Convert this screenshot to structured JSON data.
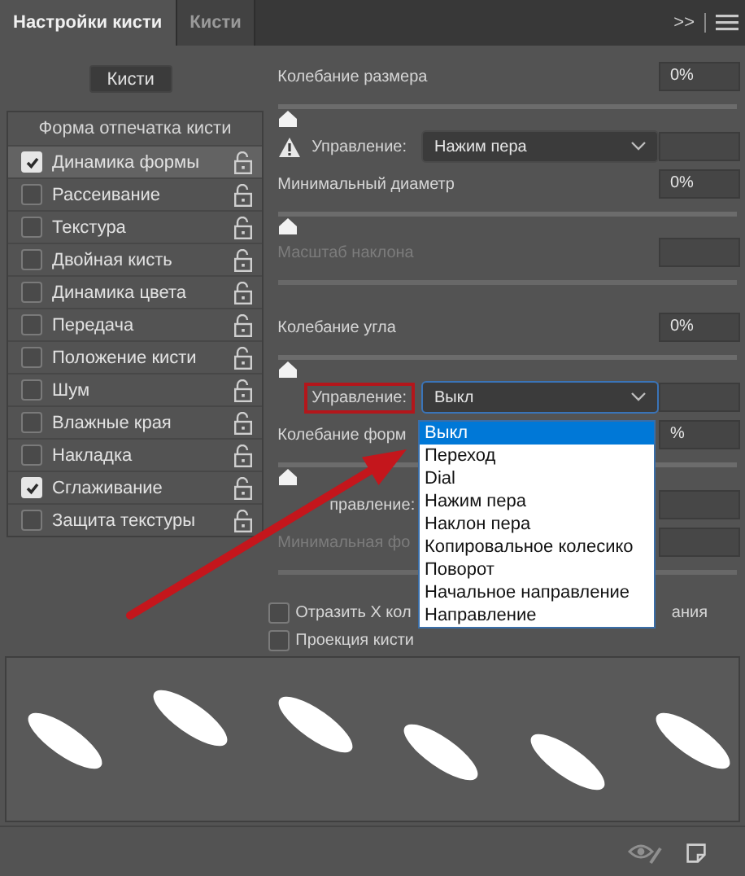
{
  "tabs": [
    {
      "label": "Настройки кисти",
      "selected": true
    },
    {
      "label": "Кисти",
      "selected": false
    }
  ],
  "panel_menu": {
    "collapse": ">>"
  },
  "brushes_button": "Кисти",
  "sidebar": {
    "header": "Форма отпечатка кисти",
    "items": [
      {
        "label": "Динамика формы",
        "checked": true,
        "selected": true
      },
      {
        "label": "Рассеивание",
        "checked": false,
        "selected": false
      },
      {
        "label": "Текстура",
        "checked": false,
        "selected": false
      },
      {
        "label": "Двойная кисть",
        "checked": false,
        "selected": false
      },
      {
        "label": "Динамика цвета",
        "checked": false,
        "selected": false
      },
      {
        "label": "Передача",
        "checked": false,
        "selected": false
      },
      {
        "label": "Положение кисти",
        "checked": false,
        "selected": false
      },
      {
        "label": "Шум",
        "checked": false,
        "selected": false
      },
      {
        "label": "Влажные края",
        "checked": false,
        "selected": false
      },
      {
        "label": "Накладка",
        "checked": false,
        "selected": false
      },
      {
        "label": "Сглаживание",
        "checked": true,
        "selected": false
      },
      {
        "label": "Защита текстуры",
        "checked": false,
        "selected": false
      }
    ]
  },
  "controls": [
    {
      "kind": "field",
      "label": "Колебание размера",
      "value": "0%",
      "disabled": false
    },
    {
      "kind": "slider",
      "level": 0
    },
    {
      "kind": "dropdown",
      "warning": true,
      "label": "Управление:",
      "value": "Нажим пера",
      "highlighted": false,
      "focused": false
    },
    {
      "kind": "field",
      "label": "Минимальный диаметр",
      "value": "0%",
      "disabled": false
    },
    {
      "kind": "slider",
      "level": 0
    },
    {
      "kind": "field",
      "label": "Масштаб наклона",
      "disabled": true
    },
    {
      "kind": "track"
    },
    {
      "kind": "field",
      "label": "Колебание угла",
      "value": "0%",
      "disabled": false
    },
    {
      "kind": "slider",
      "level": 0
    },
    {
      "kind": "dropdown",
      "warning": false,
      "label": "Управление:",
      "value": "Выкл",
      "highlighted": true,
      "focused": true
    },
    {
      "kind": "field",
      "label": "Колебание форм",
      "value": "%",
      "disabled": false
    },
    {
      "kind": "slider",
      "level": 0
    },
    {
      "kind": "control",
      "label": "правление:"
    },
    {
      "kind": "field",
      "label": "Минимальная фо",
      "disabled": true
    },
    {
      "kind": "track"
    },
    {
      "kind": "checkbox",
      "label": "Отразить X кол",
      "label_end": "ания",
      "checked": false
    },
    {
      "kind": "checkbox",
      "label": "Проекция кисти",
      "checked": false
    }
  ],
  "control_menu": {
    "items": [
      {
        "label": "Выкл",
        "selected": true
      },
      {
        "label": "Переход",
        "selected": false
      },
      {
        "label": "Dial",
        "selected": false
      },
      {
        "label": "Нажим пера",
        "selected": false
      },
      {
        "label": "Наклон пера",
        "selected": false
      },
      {
        "label": "Копировальное колесико",
        "selected": false
      },
      {
        "label": "Поворот",
        "selected": false
      },
      {
        "label": "Начальное направление",
        "selected": false
      },
      {
        "label": "Направление",
        "selected": false
      }
    ]
  }
}
